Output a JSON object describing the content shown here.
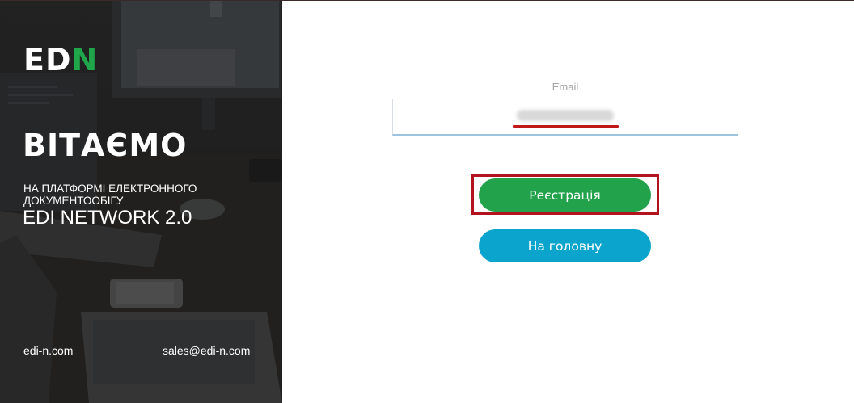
{
  "hero": {
    "logo_left": "ED",
    "logo_right": "N",
    "title": "ВІТАЄМО",
    "subtitle": "НА ПЛАТФОРМІ ЕЛЕКТРОННОГО ДОКУМЕНТООБІГУ",
    "product": "EDI NETWORK 2.0",
    "site": "edi-n.com",
    "email": "sales@edi-n.com"
  },
  "form": {
    "email_label": "Email",
    "email_value": "",
    "register_label": "Реєстрація",
    "home_label": "На головну"
  },
  "colors": {
    "brand_green": "#21a24b",
    "home_blue": "#0aa4cc",
    "highlight_red": "#b3121f"
  }
}
